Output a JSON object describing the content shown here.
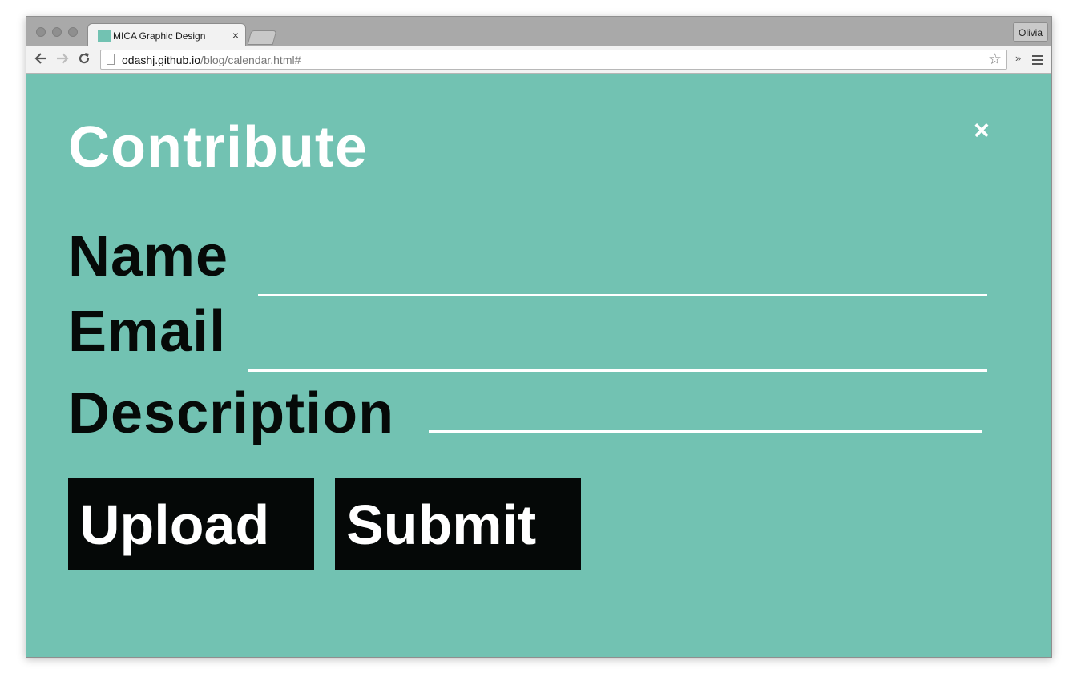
{
  "browser": {
    "tab": {
      "title": "MICA Graphic Design",
      "close_glyph": "×"
    },
    "profile_name": "Olivia",
    "address": {
      "host": "odashj.github.io",
      "path": "/blog/calendar.html#"
    },
    "icons": {
      "back": "arrow-left-icon",
      "forward": "arrow-right-icon",
      "reload": "reload-icon",
      "bookmark": "star-icon",
      "extensions": "chevron-double-right-icon",
      "menu": "hamburger-menu-icon"
    }
  },
  "page": {
    "background_color": "#72c2b2",
    "title": "Contribute",
    "close_glyph": "×",
    "form": {
      "name_label": "Name",
      "email_label": "Email",
      "description_label": "Description",
      "upload_label": "Upload",
      "submit_label": "Submit"
    }
  }
}
